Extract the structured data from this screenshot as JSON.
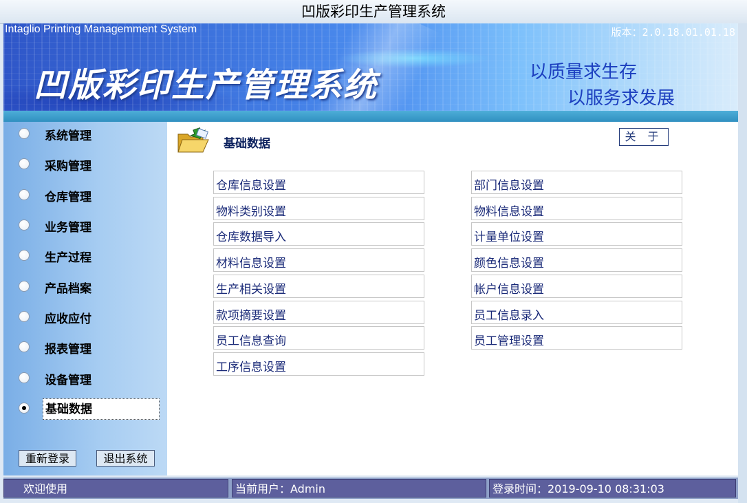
{
  "window": {
    "title": "凹版彩印生产管理系统"
  },
  "banner": {
    "english_title": "Intaglio Printing Managemment System",
    "version": "版本：2.0.18.01.01.18",
    "chinese_title": "凹版彩印生产管理系统",
    "slogan_line1": "以质量求生存",
    "slogan_line2": "以服务求发展"
  },
  "sidebar": {
    "items": [
      {
        "label": "系统管理",
        "selected": false
      },
      {
        "label": "采购管理",
        "selected": false
      },
      {
        "label": "仓库管理",
        "selected": false
      },
      {
        "label": "业务管理",
        "selected": false
      },
      {
        "label": "生产过程",
        "selected": false
      },
      {
        "label": "产品档案",
        "selected": false
      },
      {
        "label": "应收应付",
        "selected": false
      },
      {
        "label": "报表管理",
        "selected": false
      },
      {
        "label": "设备管理",
        "selected": false
      },
      {
        "label": "基础数据",
        "selected": true
      }
    ],
    "relogin_label": "重新登录",
    "exit_label": "退出系统"
  },
  "main": {
    "section_title": "基础数据",
    "section_icon": "folder-open-icon",
    "about_label": "关 于",
    "left_links": [
      "仓库信息设置",
      "物料类别设置",
      "仓库数据导入",
      "材料信息设置",
      "生产相关设置",
      "款项摘要设置",
      "员工信息查询",
      "工序信息设置"
    ],
    "right_links": [
      "部门信息设置",
      "物料信息设置",
      "计量单位设置",
      "颜色信息设置",
      "帐户信息设置",
      "员工信息录入",
      "员工管理设置"
    ]
  },
  "status": {
    "welcome": "欢迎使用",
    "current_user": "当前用户：Admin",
    "login_time": "登录时间：2019-09-10 08:31:03"
  },
  "colors": {
    "accent": "#1a2a78",
    "sidebar": "#a7cdf2",
    "status_panel": "#5d5f9d"
  }
}
